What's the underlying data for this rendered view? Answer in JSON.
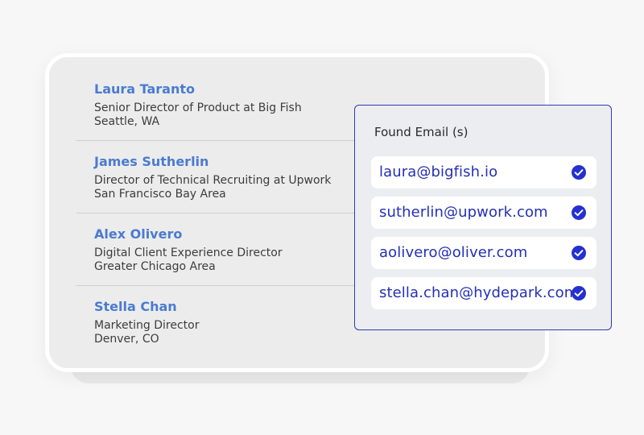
{
  "contacts": [
    {
      "name": "Laura Taranto",
      "title": "Senior Director of Product at Big Fish",
      "location": "Seattle, WA"
    },
    {
      "name": "James Sutherlin",
      "title": "Director of Technical Recruiting at Upwork",
      "location": "San Francisco Bay Area"
    },
    {
      "name": "Alex Olivero",
      "title": "Digital Client Experience Director",
      "location": "Greater Chicago Area"
    },
    {
      "name": "Stella Chan",
      "title": "Marketing Director",
      "location": "Denver, CO"
    }
  ],
  "found_emails": {
    "title": "Found Email (s)",
    "emails": [
      {
        "address": "laura@bigfish.io",
        "icon": "check-circle-icon",
        "verified": true
      },
      {
        "address": "sutherlin@upwork.com",
        "icon": "check-circle-icon",
        "verified": true
      },
      {
        "address": "aolivero@oliver.com",
        "icon": "check-circle-icon",
        "verified": true
      },
      {
        "address": "stella.chan@hydepark.com",
        "icon": "check-circle-icon",
        "verified": true
      }
    ]
  },
  "colors": {
    "name_accent": "#4a7bd0",
    "email_text": "#2430b5",
    "check_fill": "#2430d0",
    "popup_border": "#2f3bb0"
  }
}
